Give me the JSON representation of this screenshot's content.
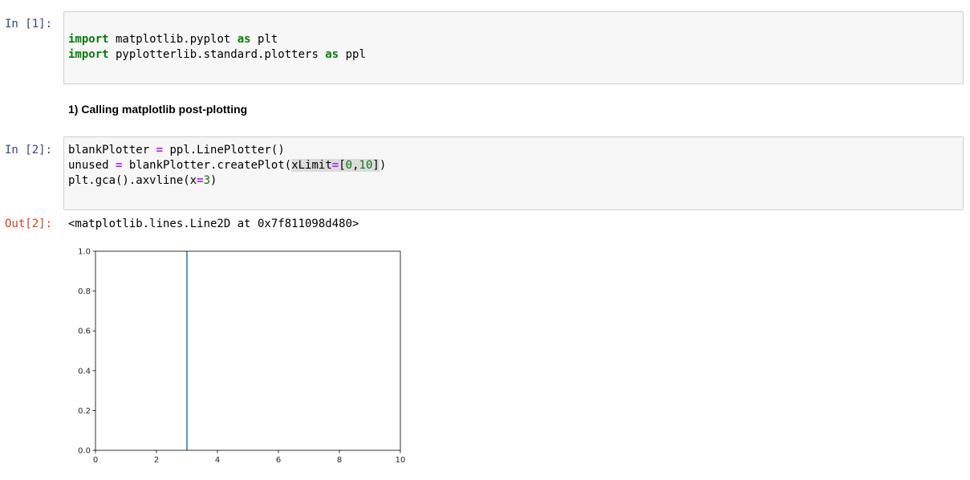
{
  "cells": [
    {
      "prompt": "In [1]:",
      "lines": [
        [
          "import",
          " matplotlib.pyplot ",
          "as",
          " plt"
        ],
        [
          "import",
          " pyplotterlib.standard.plotters ",
          "as",
          " ppl"
        ]
      ]
    },
    {
      "markdown": "1) Calling matplotlib post-plotting"
    },
    {
      "prompt": "In [2]:",
      "line1": {
        "a": "blankPlotter",
        "b": "=",
        "c": "ppl.LinePlotter()"
      },
      "line2": {
        "a": "unused",
        "b": "=",
        "c": "blankPlotter.createPlot(",
        "d": "xLimit",
        "e": "=",
        "f": "[",
        "g": "0",
        "h": ",",
        "i": "10",
        "j": "]",
        "k": ")"
      },
      "line3": {
        "a": "plt.gca().axvline(x",
        "b": "=",
        "c": "3",
        "d": ")"
      },
      "out_prompt": "Out[2]:",
      "output": "<matplotlib.lines.Line2D at 0x7f811098d480>"
    }
  ],
  "chart_data": {
    "type": "line",
    "xlim": [
      0,
      10
    ],
    "ylim": [
      0.0,
      1.0
    ],
    "x_ticks": [
      0,
      2,
      4,
      6,
      8,
      10
    ],
    "x_tick_labels": [
      "0",
      "2",
      "4",
      "6",
      "8",
      "10"
    ],
    "y_ticks": [
      0.0,
      0.2,
      0.4,
      0.6,
      0.8,
      1.0
    ],
    "y_tick_labels": [
      "0.0",
      "0.2",
      "0.4",
      "0.6",
      "0.8",
      "1.0"
    ],
    "vlines": [
      {
        "x": 3,
        "color": "#1f77b4"
      }
    ],
    "grid": false,
    "title": "",
    "xlabel": "",
    "ylabel": ""
  }
}
